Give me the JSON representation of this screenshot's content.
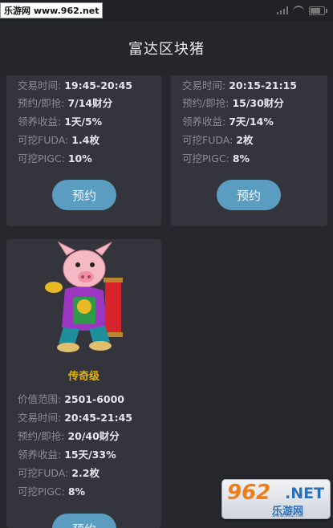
{
  "watermark_top": "乐游网 www.962.net",
  "header": {
    "title": "富达区块猪"
  },
  "card1": {
    "rows": [
      {
        "k": "交易时间:",
        "v": "19:45-20:45"
      },
      {
        "k": "预约/即抢:",
        "v": "7/14财分"
      },
      {
        "k": "领养收益:",
        "v": "1天/5%"
      },
      {
        "k": "可挖FUDA:",
        "v": "1.4枚"
      },
      {
        "k": "可挖PIGC:",
        "v": "10%"
      }
    ],
    "button": "预约"
  },
  "card2": {
    "rows": [
      {
        "k": "交易时间:",
        "v": "20:15-21:15"
      },
      {
        "k": "预约/即抢:",
        "v": "15/30财分"
      },
      {
        "k": "领养收益:",
        "v": "7天/14%"
      },
      {
        "k": "可挖FUDA:",
        "v": "2枚"
      },
      {
        "k": "可挖PIGC:",
        "v": "8%"
      }
    ],
    "button": "预约"
  },
  "card3": {
    "tier": "传奇级",
    "rows": [
      {
        "k": "价值范围:",
        "v": "2501-6000"
      },
      {
        "k": "交易时间:",
        "v": "20:45-21:45"
      },
      {
        "k": "预约/即抢:",
        "v": "20/40财分"
      },
      {
        "k": "领养收益:",
        "v": "15天/33%"
      },
      {
        "k": "可挖FUDA:",
        "v": "2.2枚"
      },
      {
        "k": "可挖PIGC:",
        "v": "8%"
      }
    ],
    "button": "预约"
  },
  "watermark_bottom": {
    "num": "962",
    "net": ".NET",
    "sub": "乐游网",
    "url": "www.962.net"
  },
  "icons": [
    "signal-icon",
    "wifi-icon",
    "battery-icon",
    "pig-mascot-icon"
  ]
}
